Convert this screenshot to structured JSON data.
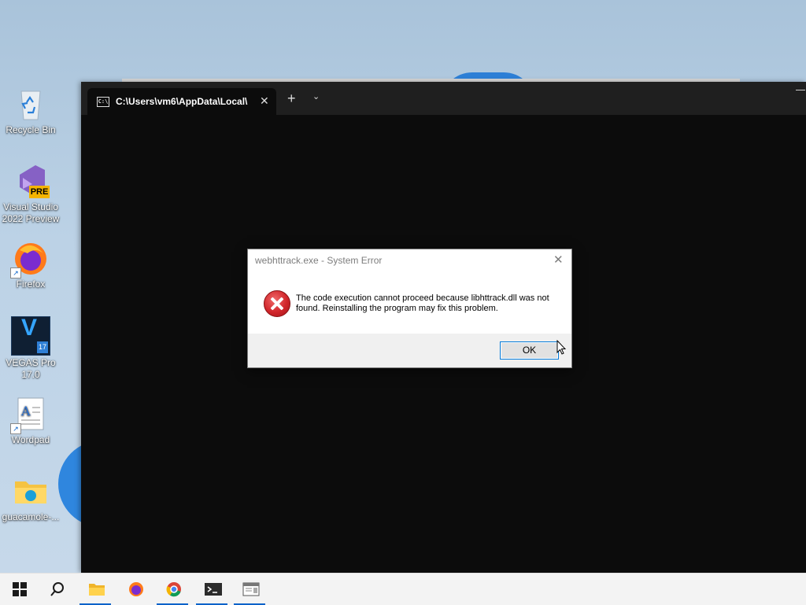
{
  "desktop": {
    "icons": [
      {
        "label": "Recycle Bin",
        "icon": "recycle-bin-icon"
      },
      {
        "label": "Visual Studio 2022 Preview",
        "icon": "visual-studio-icon",
        "badge": "PRE"
      },
      {
        "label": "Firefox",
        "icon": "firefox-icon"
      },
      {
        "label": "VEGAS Pro 17.0",
        "icon": "vegas-pro-icon",
        "badge_letter": "V",
        "badge_number": "17"
      },
      {
        "label": "Wordpad",
        "icon": "wordpad-icon"
      },
      {
        "label": "guacamole-...",
        "icon": "folder-icon"
      }
    ]
  },
  "terminal": {
    "tab_title": "C:\\Users\\vm6\\AppData\\Local\\",
    "tab_icon_text": "C:\\",
    "new_tab_symbol": "+",
    "dropdown_symbol": "⌄",
    "close_symbol": "✕"
  },
  "dialog": {
    "title": "webhttrack.exe - System Error",
    "message": "The code execution cannot proceed because libhttrack.dll was not found. Reinstalling the program may fix this problem.",
    "ok_label": "OK",
    "close_symbol": "✕"
  },
  "taskbar": {
    "items": [
      {
        "name": "start-icon",
        "running": false
      },
      {
        "name": "search-icon",
        "running": false
      },
      {
        "name": "file-explorer-icon",
        "running": true
      },
      {
        "name": "firefox-icon",
        "running": false
      },
      {
        "name": "chrome-icon",
        "running": true
      },
      {
        "name": "terminal-icon",
        "running": true
      },
      {
        "name": "app-window-icon",
        "running": true
      }
    ]
  },
  "colors": {
    "accent": "#0078d7",
    "error_red": "#d1262b",
    "terminal_bg": "#0c0c0c"
  }
}
